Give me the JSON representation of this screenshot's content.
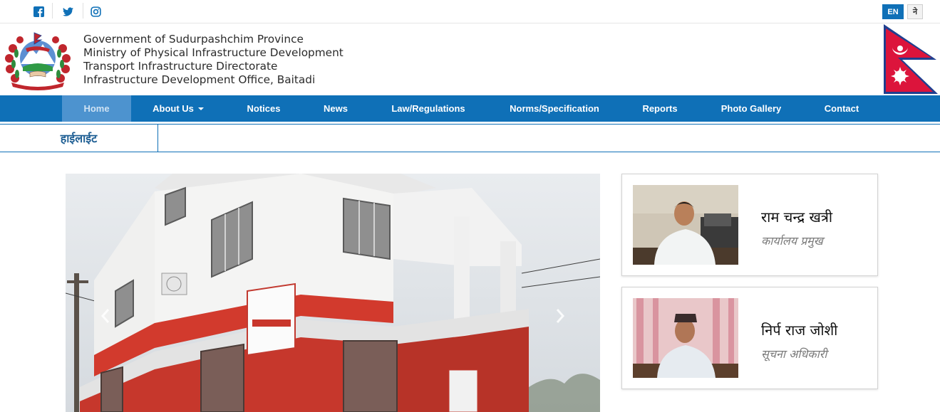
{
  "social": {
    "facebook_icon": "facebook-icon",
    "twitter_icon": "twitter-icon",
    "instagram_icon": "instagram-icon",
    "icon_color": "#0f70b7"
  },
  "language": {
    "en_label": "EN",
    "ne_label": "ने",
    "active_color": "#0f70b7"
  },
  "header": {
    "org_lines": [
      "Government of Sudurpashchim Province",
      "Ministry of Physical Infrastructure Development",
      "Transport Infrastructure Directorate",
      "Infrastructure Development Office, Baitadi"
    ],
    "emblem_icon": "nepal-emblem-icon",
    "flag_icon": "nepal-flag-icon"
  },
  "nav": {
    "items": [
      {
        "label": "Home",
        "active": true
      },
      {
        "label": "About Us",
        "dropdown": true
      },
      {
        "label": "Notices"
      },
      {
        "label": "News"
      },
      {
        "label": "Law/Regulations"
      },
      {
        "label": "Norms/Specification"
      },
      {
        "label": "Reports"
      },
      {
        "label": "Photo Gallery"
      },
      {
        "label": "Contact"
      }
    ],
    "bg_color": "#0f70b7"
  },
  "highlight": {
    "label": "हाईलाईट"
  },
  "carousel": {
    "prev_icon": "chevron-left-icon",
    "next_icon": "chevron-right-icon"
  },
  "officers": [
    {
      "name": "राम चन्द्र खत्री",
      "role": "कार्यालय प्रमुख"
    },
    {
      "name": "निर्प राज जोशी",
      "role": "सूचना अधिकारी"
    }
  ]
}
